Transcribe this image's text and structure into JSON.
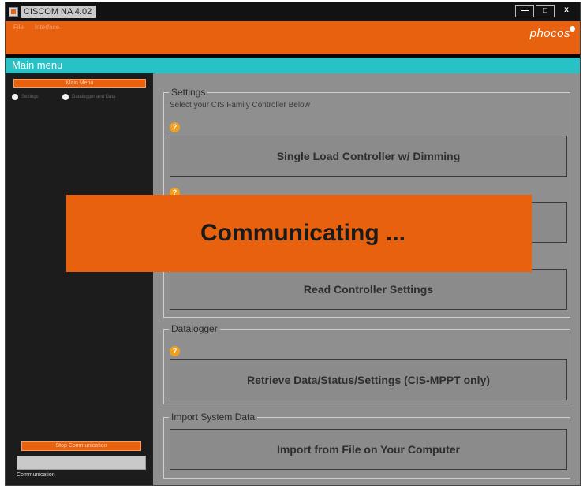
{
  "window": {
    "title": "CISCOM NA 4.02",
    "minimize_glyph": "—",
    "maximize_glyph": "□",
    "close_glyph": "x"
  },
  "menu": {
    "items": [
      "File",
      "Interface"
    ]
  },
  "brand": {
    "logo_text": "phocos"
  },
  "header": {
    "title": "Main menu"
  },
  "sidebar": {
    "main_menu_button": "Main Menu",
    "radio_settings": "Settings",
    "radio_other": "Datalogger and Data",
    "stop_button": "Stop Communication",
    "status": "Communication"
  },
  "settings": {
    "title": "Settings",
    "subtitle": "Select your CIS Family Controller Below",
    "button1": "Single Load Controller w/ Dimming",
    "button3": "Read Controller Settings"
  },
  "datalogger": {
    "title": "Datalogger",
    "button": "Retrieve Data/Status/Settings (CIS-MPPT only)"
  },
  "import": {
    "title": "Import System Data",
    "button": "Import from File on Your Computer"
  },
  "overlay": {
    "text": "Communicating ..."
  },
  "colors": {
    "accent_orange": "#e8610f",
    "cyan": "#27c1c6",
    "panel_gray": "#8f8f8f",
    "sidebar_dark": "#1c1c1c"
  },
  "icons": {
    "help": "help-icon",
    "app": "app-icon"
  }
}
